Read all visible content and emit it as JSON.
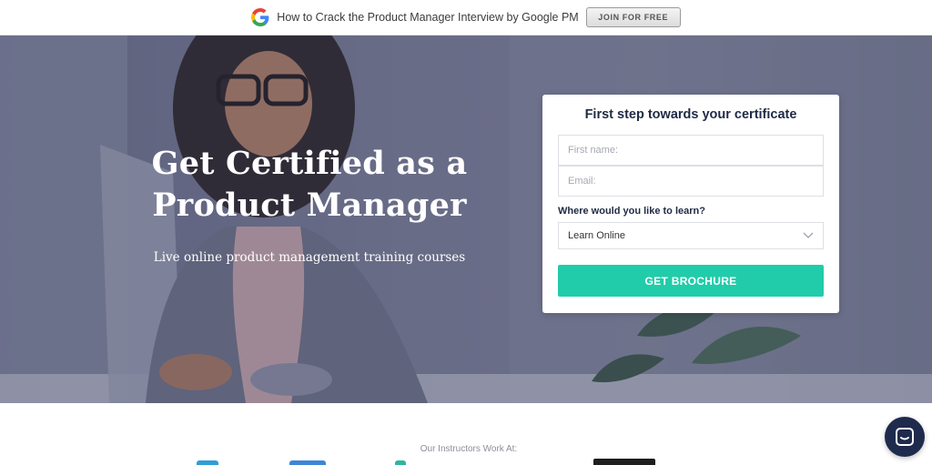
{
  "topbar": {
    "promo_text": "How to Crack the Product Manager Interview by Google PM",
    "join_label": "JOIN FOR FREE",
    "icon": "google-g-icon"
  },
  "hero": {
    "title_line1": "Get Certified as a",
    "title_line2": "Product Manager",
    "subtitle": "Live online product management training courses"
  },
  "form": {
    "title": "First step towards your certificate",
    "first_name_placeholder": "First name:",
    "email_placeholder": "Email:",
    "learn_label": "Where would you like to learn?",
    "learn_selected": "Learn Online",
    "submit_label": "GET BROCHURE"
  },
  "instructors": {
    "label": "Our Instructors Work At:"
  },
  "colors": {
    "accent": "#21ccaa",
    "heading": "#1f2a44",
    "chat": "#1f2b4d"
  },
  "icons": {
    "select_chevron": "chevron-down-icon",
    "chat": "chat-icon"
  }
}
